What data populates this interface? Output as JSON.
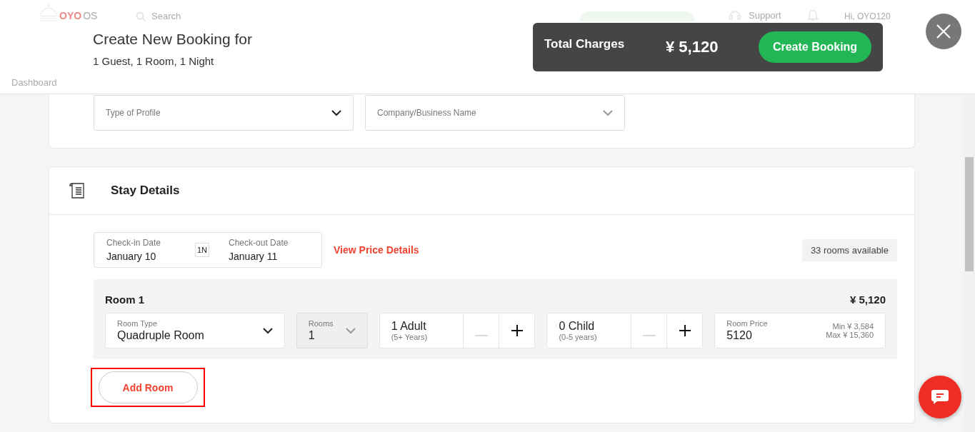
{
  "background_page": {
    "logo_brand": "OYO",
    "logo_suffix": "OS",
    "search_placeholder": "Search",
    "support": "Support",
    "greeting": "Hi, OYO120",
    "nav_item": "Dashboard"
  },
  "modal": {
    "title": "Create New Booking for",
    "subtitle": "1 Guest, 1 Room, 1 Night"
  },
  "summary_bar": {
    "label": "Total Charges",
    "amount": "¥ 5,120",
    "button": "Create Booking"
  },
  "profile_fields": [
    {
      "placeholder": "Type of Profile",
      "disabled": false
    },
    {
      "placeholder": "Company/Business Name",
      "disabled": true
    }
  ],
  "stay_details": {
    "title": "Stay Details",
    "check_in": {
      "label": "Check-in Date",
      "value": "January 10"
    },
    "nights": "1N",
    "check_out": {
      "label": "Check-out Date",
      "value": "January 11"
    },
    "price_link": "View Price Details",
    "availability": "33 rooms available",
    "rooms": [
      {
        "title": "Room 1",
        "price": "¥ 5,120",
        "room_type": {
          "label": "Room Type",
          "value": "Quadruple Room"
        },
        "room_count": {
          "label": "Rooms",
          "value": "1",
          "disabled": true
        },
        "guests": [
          {
            "value": "1 Adult",
            "hint": "(5+ Years)",
            "minus_disabled": true
          },
          {
            "value": "0 Child",
            "hint": "(0-5 years)",
            "minus_disabled": true
          }
        ],
        "room_price": {
          "label": "Room Price",
          "value": "5120",
          "min": "Min ¥ 3,584",
          "max": "Max ¥ 15,360"
        }
      }
    ],
    "add_room": "Add Room",
    "add_room_highlighted": true
  }
}
